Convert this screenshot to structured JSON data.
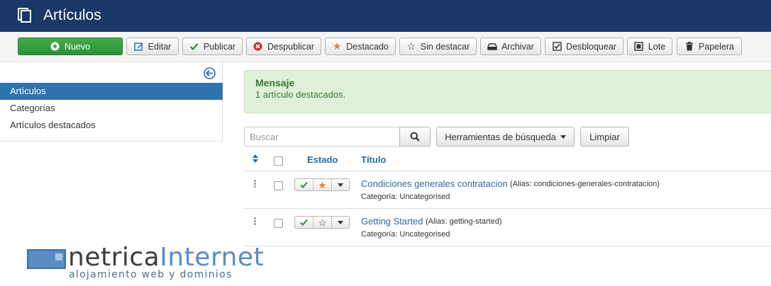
{
  "header": {
    "title": "Artículos",
    "icon": "copy-icon",
    "bg": "#1a3867"
  },
  "toolbar": {
    "new": "Nuevo",
    "edit": "Editar",
    "publish": "Publicar",
    "unpublish": "Despublicar",
    "featured": "Destacado",
    "unfeatured": "Sin destacar",
    "archive": "Archivar",
    "unlock": "Desbloquear",
    "batch": "Lote",
    "trash": "Papelera"
  },
  "sidebar": {
    "items": [
      {
        "label": "Artículos",
        "active": true
      },
      {
        "label": "Categorías",
        "active": false
      },
      {
        "label": "Artículos destacados",
        "active": false
      }
    ]
  },
  "message": {
    "heading": "Mensaje",
    "text": "1 artículo destacados."
  },
  "filters": {
    "search_placeholder": "Buscar",
    "search_tools": "Herramientas de búsqueda",
    "clear": "Limpiar"
  },
  "table": {
    "columns": {
      "status": "Estado",
      "title": "Título"
    },
    "rows": [
      {
        "title": "Condiciones generales contratacion",
        "alias": "(Alias: condiciones-generales-contratacion)",
        "category": "Categoría: Uncategorised",
        "published": true,
        "featured": true
      },
      {
        "title": "Getting Started",
        "alias": "(Alias: getting-started)",
        "category": "Categoría: Uncategorised",
        "published": true,
        "featured": false
      }
    ]
  },
  "logo": {
    "main_a": "netrica",
    "main_b": "Internet",
    "sub": "alojamiento web y dominios"
  },
  "colors": {
    "accent": "#2a6aa8",
    "success": "#3c763d",
    "new_button": "#3fae49"
  }
}
